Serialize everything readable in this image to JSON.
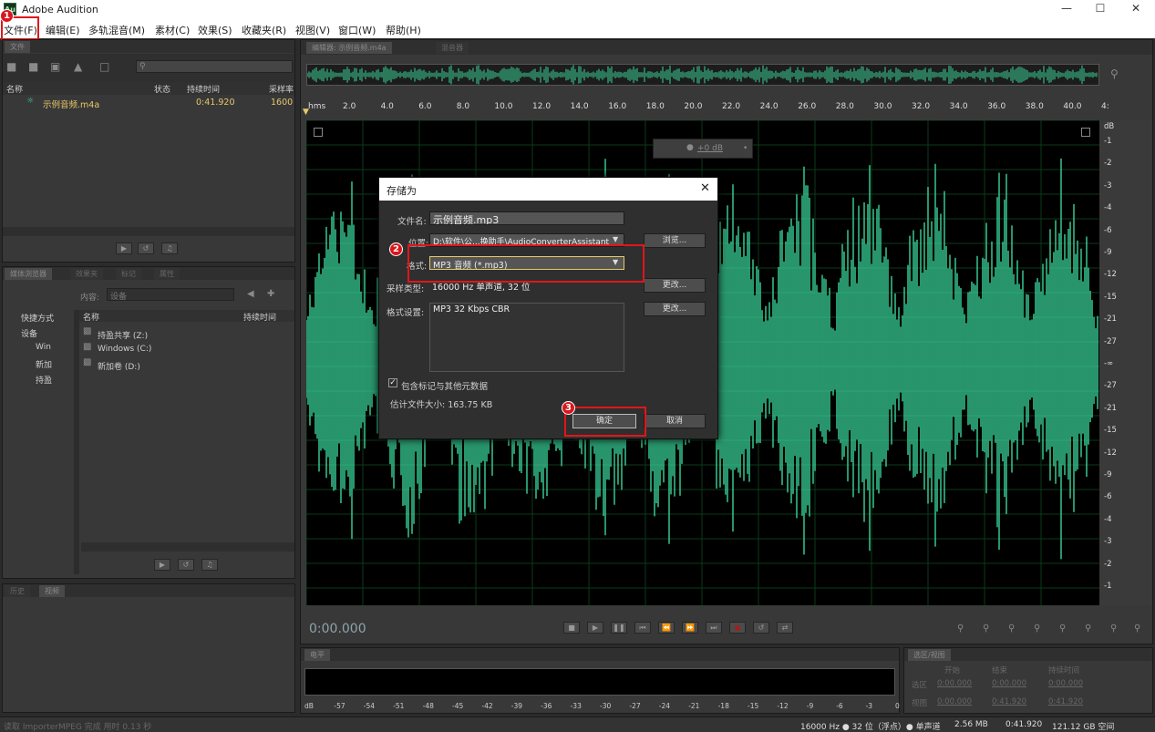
{
  "window": {
    "title": "Adobe Audition",
    "logo": "Au",
    "minimize_icon": "minimize-icon",
    "maximize_icon": "maximize-icon",
    "close_icon": "close-icon"
  },
  "menu": [
    "文件(F)",
    "编辑(E)",
    "多轨混音(M)",
    "素材(C)",
    "效果(S)",
    "收藏夹(R)",
    "视图(V)",
    "窗口(W)",
    "帮助(H)"
  ],
  "badges": [
    "1",
    "2",
    "3"
  ],
  "files_panel": {
    "tab": "文件",
    "search_placeholder": "",
    "col_name": "名称",
    "col_status": "状态",
    "col_duration": "持续时间",
    "col_samplerate": "采样率",
    "file": {
      "name": "示例音频.m4a",
      "duration": "0:41.920",
      "samplerate": "1600"
    }
  },
  "media_panel": {
    "tabs": [
      "媒体浏览器",
      "效果夹",
      "标记",
      "属性"
    ],
    "content_label": "内容:",
    "content_value": "设备",
    "col_name": "名称",
    "col_duration": "持续时间",
    "tree": [
      "快捷方式",
      "设备",
      "Win",
      "新加",
      "持盈"
    ],
    "items": [
      "持盈共享 (Z:)",
      "Windows (C:)",
      "新加卷 (D:)"
    ]
  },
  "history_panel": {
    "tabs": [
      "历史",
      "视频"
    ]
  },
  "editor": {
    "tab": "编辑器: 示例音频.m4a",
    "tab2": "混音器",
    "ruler_unit": "hms",
    "ruler": [
      "2.0",
      "4.0",
      "6.0",
      "8.0",
      "10.0",
      "12.0",
      "14.0",
      "16.0",
      "18.0",
      "20.0",
      "22.0",
      "24.0",
      "26.0",
      "28.0",
      "30.0",
      "32.0",
      "34.0",
      "36.0",
      "38.0",
      "40.0",
      "4:"
    ],
    "db_label": "dB",
    "db_scale": [
      "-1",
      "-2",
      "-3",
      "-4",
      "-6",
      "-9",
      "-12",
      "-15",
      "-21",
      "-27",
      "-∞",
      "-27",
      "-21",
      "-15",
      "-12",
      "-9",
      "-6",
      "-4",
      "-3",
      "-2",
      "-1"
    ],
    "gain": "+0 dB",
    "time": "0:00.000",
    "colors": {
      "waveform": "#3ad49a",
      "bg": "#000000",
      "accent": "#e8c86a"
    }
  },
  "dialog": {
    "title": "存储为",
    "filename_label": "文件名:",
    "filename": "示例音频.mp3",
    "location_label": "位置:",
    "location": "D:\\软件\\公...换助手\\AudioConverterAssistant",
    "browse": "浏览...",
    "format_label": "格式:",
    "format": "MP3 音频 (*.mp3)",
    "sample_label": "采样类型:",
    "sample": "16000 Hz 单声道, 32 位",
    "change": "更改...",
    "settings_label": "格式设置:",
    "settings": "MP3 32 Kbps CBR",
    "include_meta": "包含标记与其他元数据",
    "estimate": "估计文件大小: 163.75 KB",
    "ok": "确定",
    "cancel": "取消"
  },
  "meter": {
    "tab": "电平",
    "scale": [
      "dB",
      "-57",
      "-54",
      "-51",
      "-48",
      "-45",
      "-42",
      "-39",
      "-36",
      "-33",
      "-30",
      "-27",
      "-24",
      "-21",
      "-18",
      "-15",
      "-12",
      "-9",
      "-6",
      "-3",
      "0"
    ]
  },
  "selection": {
    "tab": "选区/视图",
    "col_start": "开始",
    "col_end": "结束",
    "col_duration": "持续时间",
    "row1": "选区",
    "row2": "视图",
    "sel_start": "0:00.000",
    "sel_end": "0:00.000",
    "sel_dur": "0:00.000",
    "view_start": "0:00.000",
    "view_end": "0:41.920",
    "view_dur": "0:41.920"
  },
  "status": {
    "left": "读取 ImporterMPEG 完成 用时 0.13 秒",
    "format": "16000 Hz ● 32 位（浮点）● 单声道",
    "size": "2.56 MB",
    "duration": "0:41.920",
    "free": "121.12 GB 空间"
  }
}
